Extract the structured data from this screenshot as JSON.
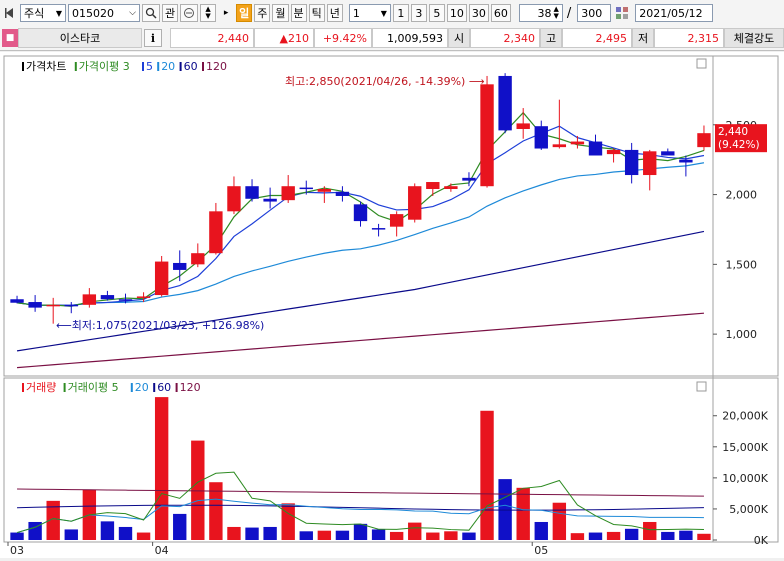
{
  "toolbar": {
    "market": "주식",
    "code": "015020",
    "btn_gwan": "관",
    "periods": [
      "일",
      "주",
      "월",
      "분",
      "틱",
      "년"
    ],
    "active_period": "일",
    "interval": "1",
    "quick": [
      "1",
      "3",
      "5",
      "10",
      "30",
      "60"
    ],
    "count": "38",
    "sep": "/",
    "total": "300",
    "date": "2021/05/12"
  },
  "infobar": {
    "name": "이스타코",
    "info_btn": "i",
    "price": "2,440",
    "change": "▲210",
    "rate": "+9.42%",
    "volume": "1,009,593",
    "open_label": "시",
    "open": "2,340",
    "high_label": "고",
    "high": "2,495",
    "low_label": "저",
    "low": "2,315",
    "strength": "체결강도"
  },
  "price_legend": [
    {
      "text": "가격차트",
      "color": "#000000"
    },
    {
      "text": "가격이평 3",
      "color": "#2e8b22"
    },
    {
      "text": "5",
      "color": "#1e3fd8"
    },
    {
      "text": "20",
      "color": "#1e8ad8"
    },
    {
      "text": "60",
      "color": "#0a0a8a"
    },
    {
      "text": "120",
      "color": "#7a1044"
    }
  ],
  "volume_legend": [
    {
      "text": "거래량",
      "color": "#e8141e"
    },
    {
      "text": "거래이평 5",
      "color": "#2e8b22"
    },
    {
      "text": "20",
      "color": "#1e8ad8"
    },
    {
      "text": "60",
      "color": "#0a0a8a"
    },
    {
      "text": "120",
      "color": "#7a1044"
    }
  ],
  "annotations": {
    "high": "최고:2,850(2021/04/26, -14.39%)",
    "low": "최저:1,075(2021/03/23, +126.98%)"
  },
  "current_tag": {
    "price": "2,440",
    "rate": "(9.42%)"
  },
  "price_axis": [
    "2,500",
    "2,000",
    "1,500",
    "1,000"
  ],
  "volume_axis": [
    "20,000K",
    "15,000K",
    "10,000K",
    "5,000K",
    "0K"
  ],
  "x_labels": [
    {
      "text": "03",
      "index": 0
    },
    {
      "text": "04",
      "index": 8
    },
    {
      "text": "05",
      "index": 29
    }
  ],
  "colors": {
    "up": "#e8141e",
    "down": "#1010c8"
  },
  "chart_data": {
    "type": "candlestick",
    "price_range": [
      700,
      2950
    ],
    "volume_range": [
      0,
      23500
    ],
    "candles": [
      {
        "o": 1250,
        "h": 1275,
        "l": 1220,
        "c": 1225,
        "v": 1200
      },
      {
        "o": 1230,
        "h": 1280,
        "l": 1160,
        "c": 1190,
        "v": 2900
      },
      {
        "o": 1200,
        "h": 1260,
        "l": 1075,
        "c": 1210,
        "v": 6300
      },
      {
        "o": 1210,
        "h": 1230,
        "l": 1150,
        "c": 1200,
        "v": 1700
      },
      {
        "o": 1210,
        "h": 1330,
        "l": 1190,
        "c": 1285,
        "v": 8100
      },
      {
        "o": 1280,
        "h": 1310,
        "l": 1240,
        "c": 1250,
        "v": 3000
      },
      {
        "o": 1250,
        "h": 1290,
        "l": 1220,
        "c": 1240,
        "v": 2100
      },
      {
        "o": 1260,
        "h": 1300,
        "l": 1230,
        "c": 1270,
        "v": 1200
      },
      {
        "o": 1280,
        "h": 1560,
        "l": 1270,
        "c": 1520,
        "v": 23000
      },
      {
        "o": 1510,
        "h": 1600,
        "l": 1380,
        "c": 1460,
        "v": 4200
      },
      {
        "o": 1500,
        "h": 1650,
        "l": 1480,
        "c": 1580,
        "v": 16000
      },
      {
        "o": 1580,
        "h": 1940,
        "l": 1570,
        "c": 1880,
        "v": 9300
      },
      {
        "o": 1880,
        "h": 2130,
        "l": 1860,
        "c": 2060,
        "v": 2100
      },
      {
        "o": 2060,
        "h": 2110,
        "l": 1950,
        "c": 1970,
        "v": 2000
      },
      {
        "o": 1970,
        "h": 2050,
        "l": 1900,
        "c": 1950,
        "v": 2100
      },
      {
        "o": 1960,
        "h": 2140,
        "l": 1940,
        "c": 2060,
        "v": 5900
      },
      {
        "o": 2050,
        "h": 2100,
        "l": 2000,
        "c": 2040,
        "v": 1400
      },
      {
        "o": 2020,
        "h": 2060,
        "l": 1940,
        "c": 2040,
        "v": 1500
      },
      {
        "o": 2020,
        "h": 2060,
        "l": 1950,
        "c": 1990,
        "v": 1500
      },
      {
        "o": 1930,
        "h": 1950,
        "l": 1770,
        "c": 1810,
        "v": 2600
      },
      {
        "o": 1760,
        "h": 1790,
        "l": 1700,
        "c": 1750,
        "v": 1700
      },
      {
        "o": 1770,
        "h": 1880,
        "l": 1700,
        "c": 1860,
        "v": 1300
      },
      {
        "o": 1820,
        "h": 2080,
        "l": 1800,
        "c": 2060,
        "v": 2800
      },
      {
        "o": 2040,
        "h": 2080,
        "l": 1990,
        "c": 2090,
        "v": 1200
      },
      {
        "o": 2040,
        "h": 2080,
        "l": 2020,
        "c": 2060,
        "v": 1400
      },
      {
        "o": 2120,
        "h": 2160,
        "l": 2060,
        "c": 2100,
        "v": 1200
      },
      {
        "o": 2060,
        "h": 2850,
        "l": 2050,
        "c": 2790,
        "v": 20800
      },
      {
        "o": 2850,
        "h": 2870,
        "l": 2440,
        "c": 2460,
        "v": 9800
      },
      {
        "o": 2470,
        "h": 2620,
        "l": 2400,
        "c": 2510,
        "v": 8400
      },
      {
        "o": 2490,
        "h": 2530,
        "l": 2320,
        "c": 2330,
        "v": 2900
      },
      {
        "o": 2340,
        "h": 2680,
        "l": 2330,
        "c": 2360,
        "v": 6000
      },
      {
        "o": 2360,
        "h": 2420,
        "l": 2330,
        "c": 2380,
        "v": 1100
      },
      {
        "o": 2380,
        "h": 2430,
        "l": 2330,
        "c": 2280,
        "v": 1200
      },
      {
        "o": 2290,
        "h": 2330,
        "l": 2230,
        "c": 2320,
        "v": 1300
      },
      {
        "o": 2320,
        "h": 2370,
        "l": 2080,
        "c": 2140,
        "v": 1800
      },
      {
        "o": 2140,
        "h": 2320,
        "l": 2030,
        "c": 2310,
        "v": 2900
      },
      {
        "o": 2310,
        "h": 2330,
        "l": 2280,
        "c": 2280,
        "v": 1300
      },
      {
        "o": 2250,
        "h": 2280,
        "l": 2130,
        "c": 2230,
        "v": 1500
      },
      {
        "o": 2340,
        "h": 2495,
        "l": 2315,
        "c": 2440,
        "v": 1000
      }
    ]
  }
}
